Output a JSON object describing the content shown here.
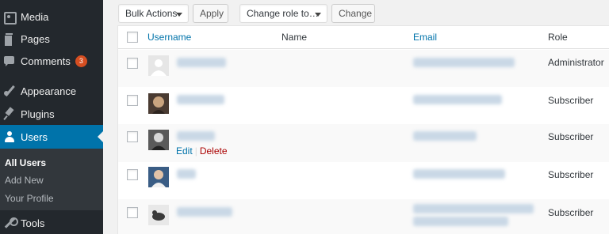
{
  "sidebar": {
    "items": [
      {
        "label": "Media",
        "icon": "media-icon"
      },
      {
        "label": "Pages",
        "icon": "pages-icon"
      },
      {
        "label": "Comments",
        "icon": "comments-icon",
        "badge": "3"
      },
      {
        "label": "Appearance",
        "icon": "appearance-icon"
      },
      {
        "label": "Plugins",
        "icon": "plugins-icon"
      },
      {
        "label": "Users",
        "icon": "users-icon",
        "current": true
      },
      {
        "label": "Tools",
        "icon": "tools-icon"
      }
    ],
    "submenu": [
      {
        "label": "All Users",
        "active": true
      },
      {
        "label": "Add New"
      },
      {
        "label": "Your Profile"
      }
    ]
  },
  "toolbar": {
    "bulk_actions": "Bulk Actions",
    "apply": "Apply",
    "change_role": "Change role to…",
    "change": "Change"
  },
  "table": {
    "headers": {
      "username": "Username",
      "name": "Name",
      "email": "Email",
      "role": "Role"
    },
    "rows": [
      {
        "role": "Administrator"
      },
      {
        "role": "Subscriber"
      },
      {
        "role": "Subscriber",
        "actions": {
          "edit": "Edit",
          "delete": "Delete"
        }
      },
      {
        "role": "Subscriber"
      },
      {
        "role": "Subscriber"
      }
    ]
  },
  "colors": {
    "sidebar_bg": "#23282d",
    "current_menu": "#0073aa",
    "link": "#0073aa",
    "delete": "#aa0000",
    "badge": "#d54e21"
  }
}
